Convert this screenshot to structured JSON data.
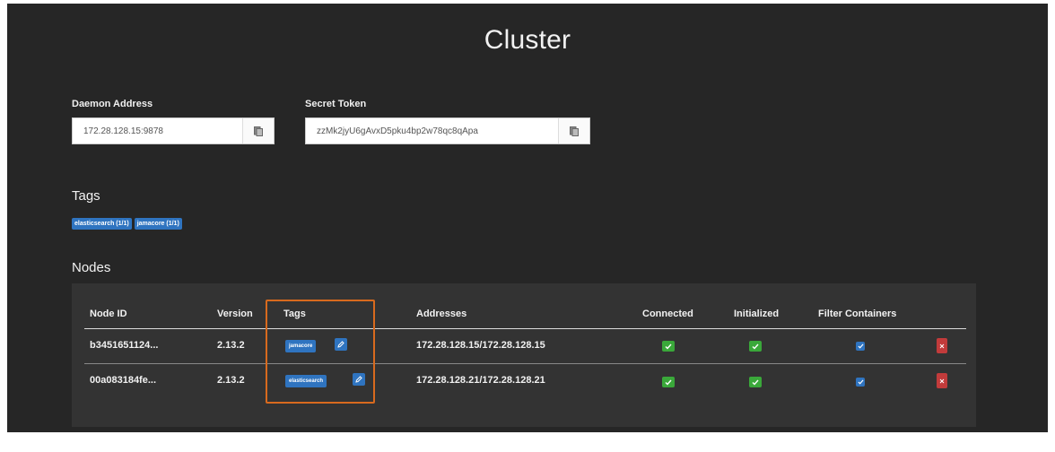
{
  "page": {
    "title": "Cluster"
  },
  "daemon": {
    "label": "Daemon Address",
    "value": "172.28.128.15:9878"
  },
  "secret": {
    "label": "Secret Token",
    "value": "zzMk2jyU6gAvxD5pku4bp2w78qc8qApa"
  },
  "tags": {
    "heading": "Tags",
    "items": [
      "elasticsearch (1/1)",
      "jamacore (1/1)"
    ]
  },
  "nodes": {
    "heading": "Nodes",
    "columns": {
      "node_id": "Node ID",
      "version": "Version",
      "tags": "Tags",
      "addresses": "Addresses",
      "connected": "Connected",
      "initialized": "Initialized",
      "filter_containers": "Filter Containers"
    },
    "rows": [
      {
        "node_id": "b3451651124...",
        "version": "2.13.2",
        "tag": "jamacore",
        "address": "172.28.128.15/172.28.128.15",
        "connected": true,
        "initialized": true,
        "filter_containers": true
      },
      {
        "node_id": "00a083184fe...",
        "version": "2.13.2",
        "tag": "elasticsearch",
        "address": "172.28.128.21/172.28.128.21",
        "connected": true,
        "initialized": true,
        "filter_containers": true
      }
    ]
  },
  "icons": {
    "copy": "clipboard-icon",
    "edit": "edit-icon",
    "check": "checkmark-icon",
    "delete": "delete-icon"
  },
  "colors": {
    "background": "#262626",
    "accent": "#2f74c0",
    "success": "#3aa83a",
    "danger": "#c23b3b",
    "highlight": "#d86a1e"
  }
}
